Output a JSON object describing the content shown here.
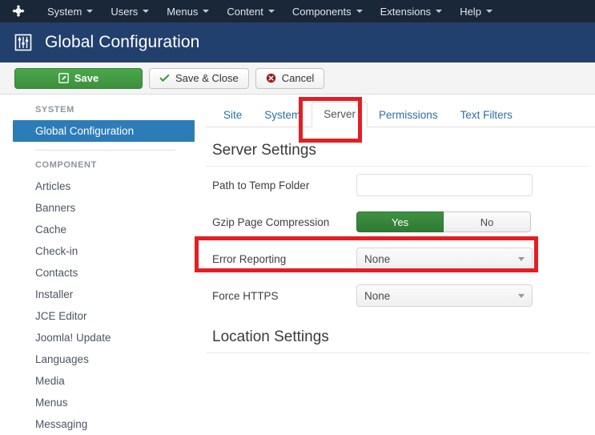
{
  "topbar": {
    "logo_icon": "joomla-logo-icon",
    "menu": [
      {
        "label": "System",
        "caret": true
      },
      {
        "label": "Users",
        "caret": true
      },
      {
        "label": "Menus",
        "caret": true
      },
      {
        "label": "Content",
        "caret": true
      },
      {
        "label": "Components",
        "caret": true
      },
      {
        "label": "Extensions",
        "caret": true
      },
      {
        "label": "Help",
        "caret": true
      }
    ]
  },
  "header": {
    "title": "Global Configuration",
    "icon": "sliders-icon"
  },
  "toolbar": {
    "save_label": "Save",
    "save_icon": "pencil-square-icon",
    "save_close_label": "Save & Close",
    "save_close_icon": "check-icon",
    "cancel_label": "Cancel",
    "cancel_icon": "circle-x-icon"
  },
  "sidebar": {
    "system_heading": "SYSTEM",
    "system_items": [
      {
        "label": "Global Configuration",
        "active": true
      }
    ],
    "component_heading": "COMPONENT",
    "component_items": [
      {
        "label": "Articles"
      },
      {
        "label": "Banners"
      },
      {
        "label": "Cache"
      },
      {
        "label": "Check-in"
      },
      {
        "label": "Contacts"
      },
      {
        "label": "Installer"
      },
      {
        "label": "JCE Editor"
      },
      {
        "label": "Joomla! Update"
      },
      {
        "label": "Languages"
      },
      {
        "label": "Media"
      },
      {
        "label": "Menus"
      },
      {
        "label": "Messaging"
      }
    ]
  },
  "main": {
    "tabs": [
      {
        "label": "Site",
        "active": false
      },
      {
        "label": "System",
        "active": false
      },
      {
        "label": "Server",
        "active": true
      },
      {
        "label": "Permissions",
        "active": false
      },
      {
        "label": "Text Filters",
        "active": false
      }
    ],
    "server_settings_title": "Server Settings",
    "location_settings_title": "Location Settings",
    "fields": {
      "temp_folder": {
        "label": "Path to Temp Folder",
        "value": "",
        "placeholder": ""
      },
      "gzip": {
        "label": "Gzip Page Compression",
        "yes_label": "Yes",
        "no_label": "No",
        "selected": "Yes"
      },
      "error_reporting": {
        "label": "Error Reporting",
        "value": "None"
      },
      "force_https": {
        "label": "Force HTTPS",
        "value": "None"
      }
    }
  },
  "annotations": {
    "color": "#e31e24",
    "boxes": [
      {
        "name": "server-tab-highlight"
      },
      {
        "name": "gzip-row-highlight"
      }
    ]
  },
  "colors": {
    "topbar_bg": "#1a2738",
    "titlebar_bg": "#22406d",
    "sidebar_active": "#2c7cb8",
    "save_green": "#3d8f3d",
    "toggle_on_green": "#2f7a35",
    "link_blue": "#2c6ea8",
    "annotation_red": "#e31e24"
  }
}
